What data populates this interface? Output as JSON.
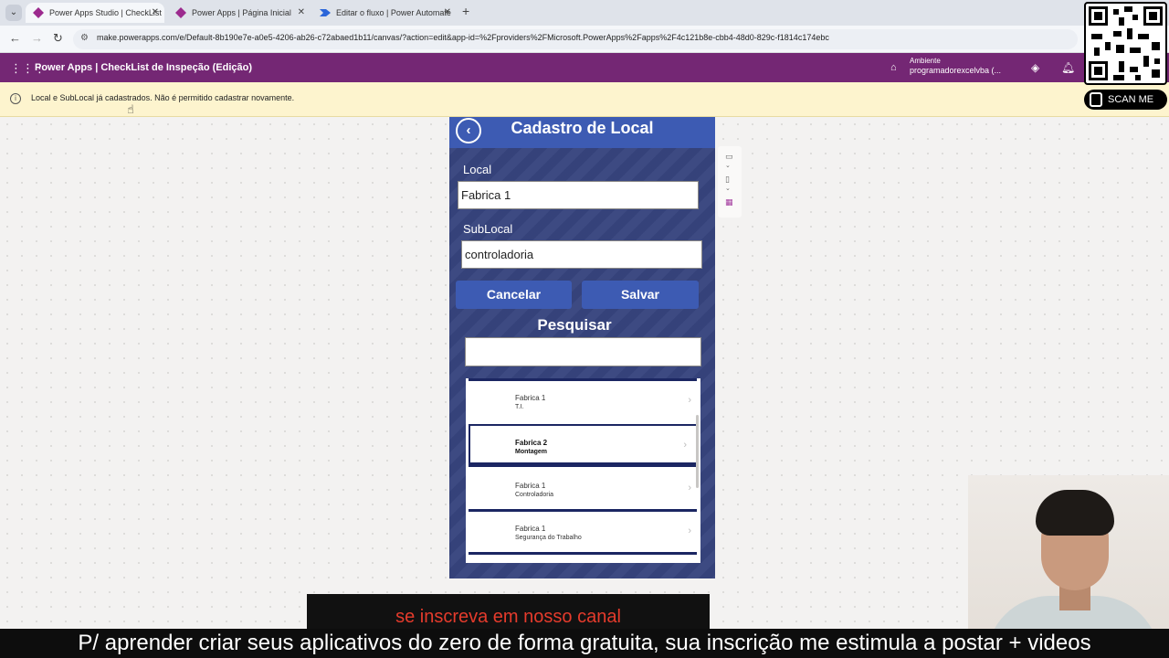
{
  "browser": {
    "tabs": [
      {
        "title": "Power Apps Studio | CheckList",
        "active": true
      },
      {
        "title": "Power Apps | Página Inicial",
        "active": false
      },
      {
        "title": "Editar o fluxo | Power Automate",
        "active": false
      }
    ],
    "url": "make.powerapps.com/e/Default-8b190e7e-a0e5-4206-ab26-c72abaed1b11/canvas/?action=edit&app-id=%2Fproviders%2FMicrosoft.PowerApps%2Fapps%2F4c121b8e-cbb4-48d0-829c-f1814c174ebc"
  },
  "header": {
    "title": "Power Apps  |  CheckList de Inspeção (Edição)",
    "environment_label": "Ambiente",
    "environment_value": "programadorexcelvba (..."
  },
  "notification": {
    "message": "Local e SubLocal já cadastrados. Não é permitido cadastrar novamente."
  },
  "app": {
    "title": "Cadastro de Local",
    "back_icon": "chevron-left-icon",
    "local_label": "Local",
    "local_value": "Fabrica 1",
    "sublocal_label": "SubLocal",
    "sublocal_value": "controladoria",
    "cancel_label": "Cancelar",
    "save_label": "Salvar",
    "search_title": "Pesquisar",
    "search_value": "",
    "gallery": [
      {
        "local": "Fabrica 1",
        "sublocal": "T.I.",
        "selected": false
      },
      {
        "local": "Fabrica 2",
        "sublocal": "Montagem",
        "selected": true
      },
      {
        "local": "Fabrica 1",
        "sublocal": "Controladoria",
        "selected": false
      },
      {
        "local": "Fabrica 1",
        "sublocal": "Segurança do Trabalho",
        "selected": false
      }
    ]
  },
  "overlay": {
    "scan_label": "SCAN ME",
    "subtitle_top": "se inscreva em nosso canal",
    "subtitle_bottom": "P/ aprender criar seus aplicativos do zero de forma gratuita, sua inscrição me estimula a postar + videos"
  },
  "colors": {
    "header_purple": "#742774",
    "app_background": "#37447e",
    "app_header": "#3d5bb3",
    "gallery_separator": "#1b2662",
    "notification_bg": "#fdf4ce",
    "subtitle_red": "#e53b2c"
  }
}
